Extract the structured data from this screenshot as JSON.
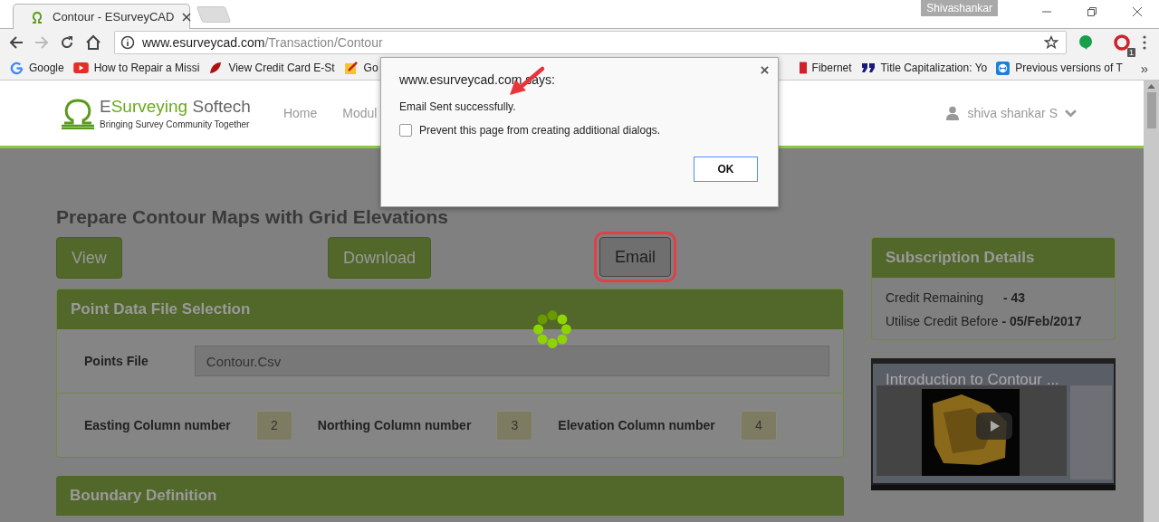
{
  "browser": {
    "tabs": [
      {
        "title": "Contour - ESurveyCAD",
        "selected": true
      }
    ],
    "profile": "Shivashankar",
    "address": {
      "host": "www.esurveycad.com",
      "path": "/Transaction/Contour"
    },
    "extension_badge": "1",
    "bookmarks": [
      {
        "label": "Google",
        "kind": "google"
      },
      {
        "label": "How to Repair a Missi",
        "kind": "youtube"
      },
      {
        "label": "View Credit Card E-St",
        "kind": "card"
      },
      {
        "label": "Go",
        "kind": "pencil"
      },
      {
        "label": "Fibernet",
        "kind": "act"
      },
      {
        "label": "Title Capitalization: Yo",
        "kind": "quote"
      },
      {
        "label": "Previous versions of T",
        "kind": "teamviewer"
      }
    ],
    "more": "»"
  },
  "header": {
    "brand": [
      {
        "text": "E",
        "kind": "plain"
      },
      {
        "text": "Surveying",
        "kind": "accent"
      },
      {
        "text": " Softech",
        "kind": "plain"
      }
    ],
    "tagline": "Bringing Survey Community Together",
    "nav": [
      "Home",
      "Modul"
    ],
    "user": "shiva shankar S"
  },
  "title": "Prepare Contour Maps with Grid Elevations",
  "actions": [
    {
      "label": "View",
      "kind": "filled",
      "highlighted": false
    },
    {
      "label": "Download",
      "kind": "filled",
      "highlighted": false
    },
    {
      "label": "Email",
      "kind": "active",
      "highlighted": true
    }
  ],
  "point_panel": {
    "title": "Point Data File Selection",
    "file": {
      "label": "Points File",
      "value": "Contour.Csv"
    },
    "columns": [
      {
        "label": "Easting Column number",
        "value": "2"
      },
      {
        "label": "Northing Column number",
        "value": "3"
      },
      {
        "label": "Elevation Column number",
        "value": "4"
      }
    ]
  },
  "boundary_panel": {
    "title": "Boundary Definition"
  },
  "subscription": {
    "title": "Subscription Details",
    "rows": [
      {
        "label": "Credit Remaining",
        "value": "- 43"
      },
      {
        "label": "Utilise Credit Before",
        "value": "- 05/Feb/2017"
      }
    ]
  },
  "video": {
    "title": "Introduction to Contour ..."
  },
  "dialog": {
    "origin": "www.esurveycad.com says:",
    "message": "Email Sent successfully.",
    "checkbox": {
      "label": "Prevent this page from creating additional dialogs.",
      "checked": false
    },
    "ok": "OK"
  }
}
